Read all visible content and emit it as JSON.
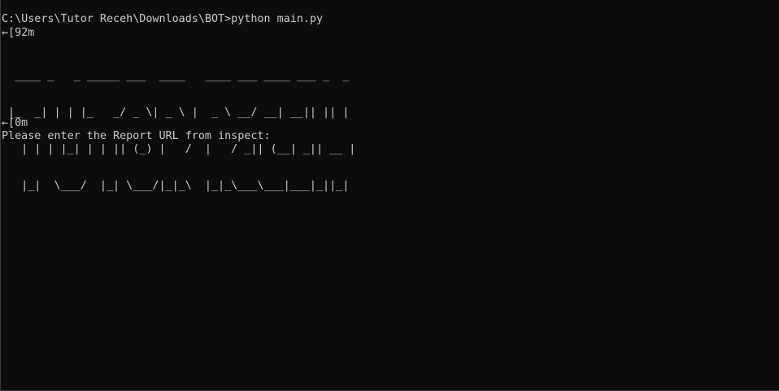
{
  "console": {
    "prompt_command": "C:\\Users\\Tutor Receh\\Downloads\\BOT>python main.py",
    "escape_start": "←[92m",
    "banner_lines": [
      "  ____ _   _ _____ ___  ____   ____ ___ ____ ___ _  _",
      " |_  _| | | |_   _/ _ \\| _ \\ |  _ \\ __/ __| __|| || |",
      "   | | | |_| | | || (_) |   /  |   / _|| (__| _|| __ |",
      "   |_|  \\___/  |_| \\___/|_|_\\  |_|_\\___\\___|___|_||_|"
    ],
    "escape_end": "←[0m",
    "input_prompt": "Please enter the Report URL from inspect:"
  },
  "colors": {
    "background": "#0c0c0c",
    "text": "#cccccc"
  }
}
